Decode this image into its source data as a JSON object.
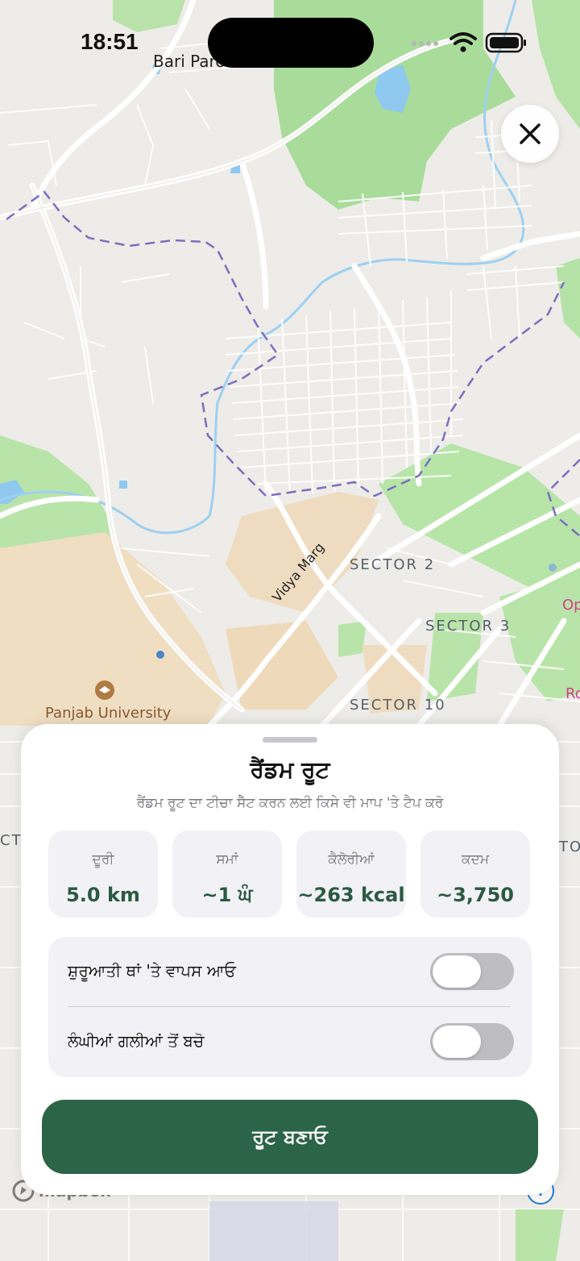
{
  "status_bar": {
    "time": "18:51"
  },
  "map": {
    "labels": {
      "bari_paroli": "Bari Paroli",
      "sector_2": "SECTOR 2",
      "sector_3": "SECTOR 3",
      "sector_10": "SECTOR 10",
      "vidya_marg": "Vidya Marg",
      "panjab_university": "Panjab University",
      "edge_left": "CT",
      "edge_right": "TO",
      "pink_1": "Op",
      "pink_2": "Ro"
    },
    "attribution": "mapbox",
    "info_symbol": "i"
  },
  "close_button": {
    "icon": "close-icon"
  },
  "sheet": {
    "title": "ਰੈਂਡਮ ਰੂਟ",
    "subtitle": "ਰੈਂਡਮ ਰੂਟ ਦਾ ਟੀਚਾ ਸੈੱਟ ਕਰਨ ਲਈ ਕਿਸੇ ਵੀ ਮਾਪ 'ਤੇ ਟੈਪ ਕਰੋ",
    "stats": [
      {
        "label": "ਦੂਰੀ",
        "value": "5.0 km"
      },
      {
        "label": "ਸਮਾਂ",
        "value": "~1 ਘੰ"
      },
      {
        "label": "ਕੈਲੋਰੀਆਂ",
        "value": "~263 kcal"
      },
      {
        "label": "ਕਦਮ",
        "value": "~3,750"
      }
    ],
    "options": [
      {
        "label": "ਸ਼ੁਰੂਆਤੀ ਥਾਂ 'ਤੇ ਵਾਪਸ ਆਓ",
        "enabled": false
      },
      {
        "label": "ਲੰਘੀਆਂ ਗਲੀਆਂ ਤੋਂ ਬਚੋ",
        "enabled": false
      }
    ],
    "create_button": "ਰੂਟ ਬਣਾਓ"
  },
  "colors": {
    "accent_green": "#2c6448",
    "stat_value_green": "#2b5a42",
    "park_green": "#a9dc9a",
    "water_blue": "#8fc9ef",
    "boundary_purple": "#7a6fc0"
  }
}
